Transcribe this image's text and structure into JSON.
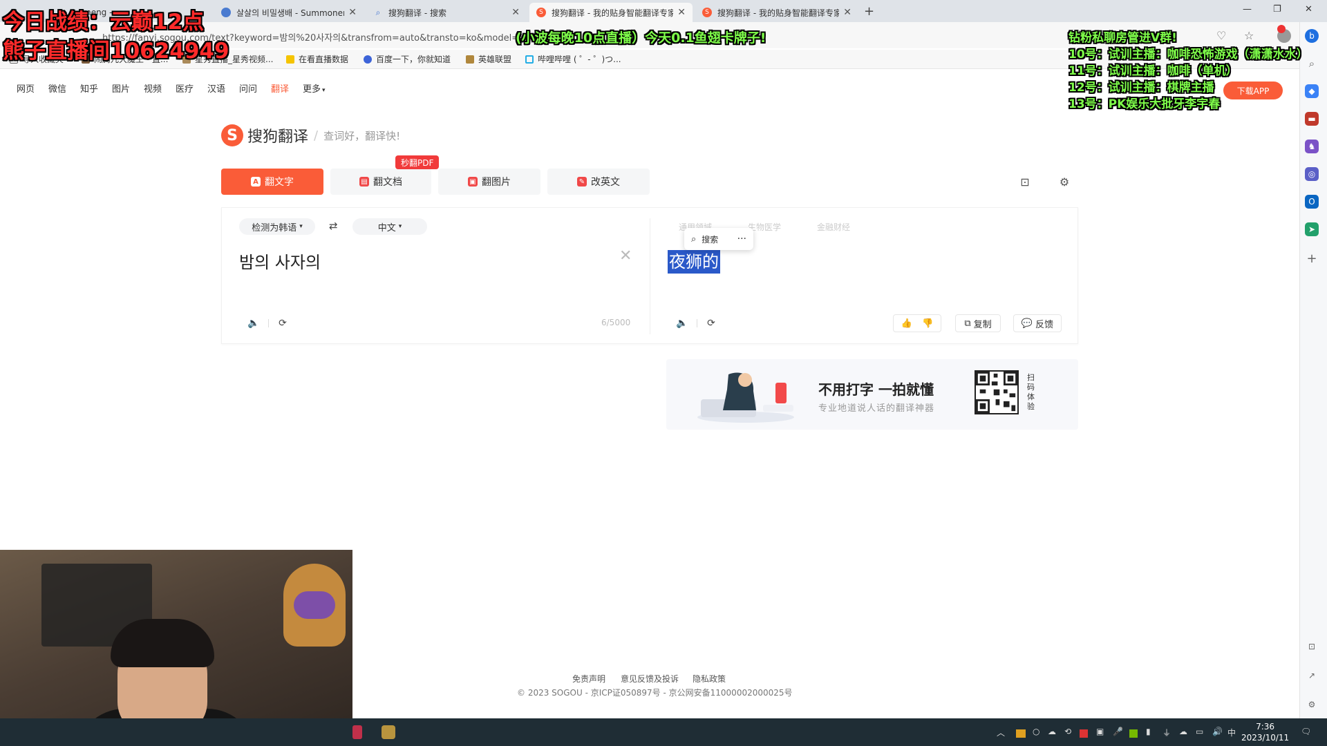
{
  "tabs": [
    {
      "title": "meng - ",
      "active": false
    },
    {
      "title": "살살의 비밀생배 - Summoner Sta",
      "active": false
    },
    {
      "title": "搜狗翻译 - 搜索",
      "active": false
    },
    {
      "title": "搜狗翻译 - 我的贴身智能翻译专家",
      "active": true
    },
    {
      "title": "搜狗翻译 - 我的贴身智能翻译专家",
      "active": false
    }
  ],
  "address": {
    "url": "https://fanyi.sogou.com/text?keyword=밤의%20사자의&transfrom=auto&transto=ko&model=g"
  },
  "bookmarks": [
    "导入收藏夹",
    "闹腾儿大魔王 - 直...",
    "星秀直播_星秀视频...",
    "在看直播数据",
    "百度一下，你就知道",
    "英雄联盟",
    "哔哩哔哩 ( ゜- ゜)つ..."
  ],
  "nav": {
    "items": [
      "网页",
      "微信",
      "知乎",
      "图片",
      "视频",
      "医疗",
      "汉语",
      "问问",
      "翻译",
      "更多"
    ],
    "active": "翻译",
    "download_app": "下载APP"
  },
  "brand": {
    "logo_letter": "S",
    "name": "搜狗翻译",
    "slogan": "查词好，翻译快!"
  },
  "modes": {
    "translate_text": "翻文字",
    "translate_doc": "翻文档",
    "translate_image": "翻图片",
    "correct_english": "改英文",
    "pdf_badge": "秒翻PDF"
  },
  "source": {
    "lang": "检测为韩语",
    "text": "밤의 사자의",
    "count": "6/5000"
  },
  "target": {
    "lang": "中文",
    "text": "夜狮的",
    "domains": [
      "通用领域",
      "生物医学",
      "金融财经"
    ],
    "popup_search": "搜索",
    "copy": "复制",
    "feedback": "反馈"
  },
  "banner": {
    "headline": "不用打字 一拍就懂",
    "subline": "专业地道说人话的翻译神器",
    "scan_text": "扫码体验"
  },
  "footer": {
    "links": [
      "免责声明",
      "意见反馈及投诉",
      "隐私政策"
    ],
    "copyright": "© 2023 SOGOU - 京ICP证050897号 - 京公网安备11000002000025号"
  },
  "overlays": {
    "stats": "今日战绩：云巅12点",
    "room": "熊子直播间10624949",
    "schedule": "(小波每晚10点直播）今天0.1鱼翅卡牌子!",
    "lines": [
      "钻粉私聊房管进V群!",
      "10号：试训主播：咖啡恐怖游戏（潇潇水水）",
      "11号：试训主播：咖啡（单机）",
      "12号：试训主播：棋牌主播",
      "13号：PK娱乐大批牙李宇春"
    ]
  },
  "taskbar": {
    "time": "7:36",
    "date": "2023/10/11",
    "ime": "中"
  },
  "colors": {
    "accent": "#fa5c38",
    "selection": "#2a59c9",
    "overlay_red": "#ff2a2a",
    "overlay_green": "#7fff4a"
  }
}
